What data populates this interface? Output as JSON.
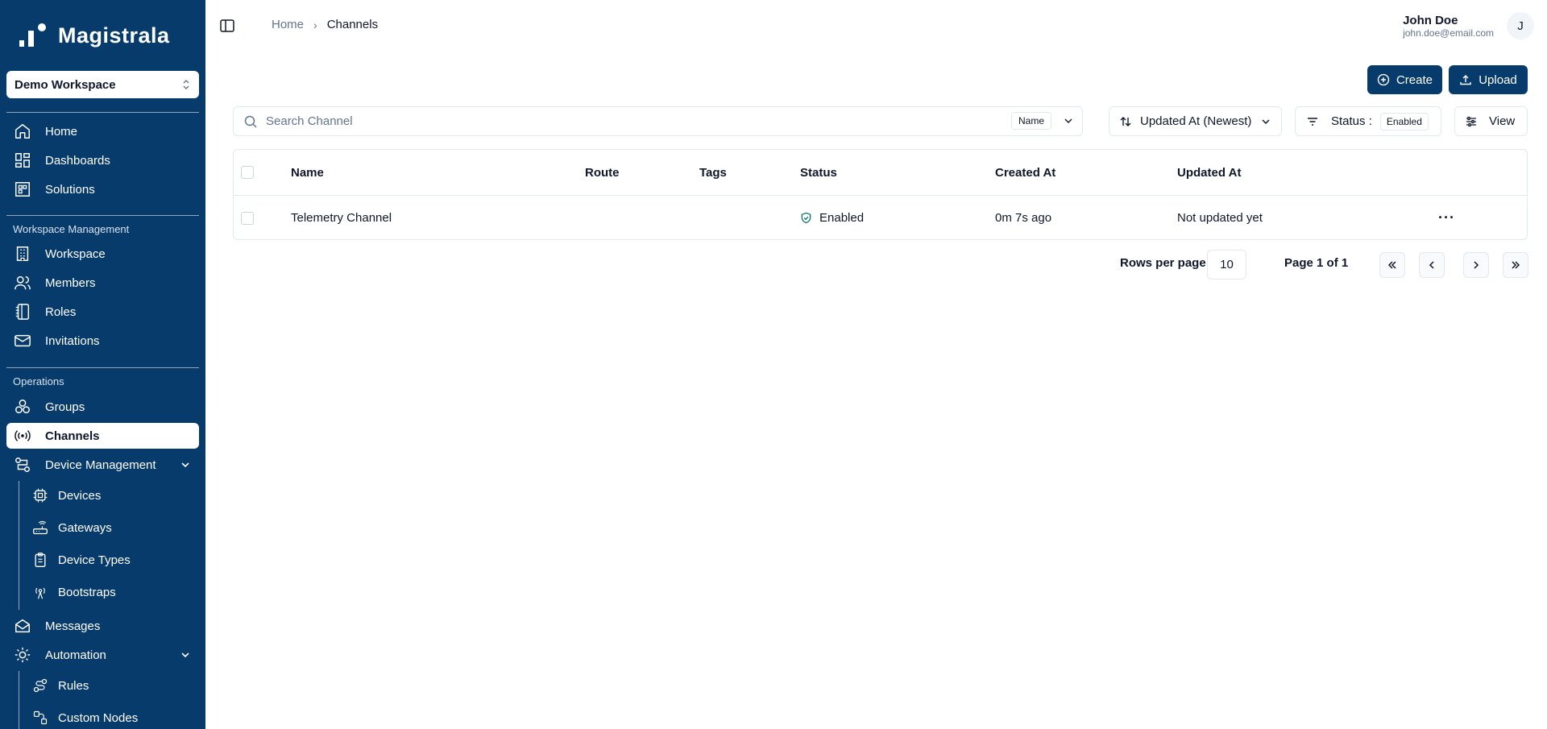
{
  "app": {
    "name": "Magistrala"
  },
  "workspace": {
    "selected": "Demo Workspace"
  },
  "sidebar": {
    "top_items": [
      {
        "label": "Home",
        "icon": "home-icon"
      },
      {
        "label": "Dashboards",
        "icon": "dashboard-icon"
      },
      {
        "label": "Solutions",
        "icon": "solutions-icon"
      }
    ],
    "section_workspace": "Workspace Management",
    "workspace_items": [
      {
        "label": "Workspace",
        "icon": "building-icon"
      },
      {
        "label": "Members",
        "icon": "users-icon"
      },
      {
        "label": "Roles",
        "icon": "notebook-icon"
      },
      {
        "label": "Invitations",
        "icon": "mail-icon"
      }
    ],
    "section_operations": "Operations",
    "operations_items": [
      {
        "label": "Groups",
        "icon": "groups-icon"
      },
      {
        "label": "Channels",
        "icon": "radio-icon",
        "active": true
      },
      {
        "label": "Device Management",
        "icon": "workflow-icon",
        "expanded": true
      }
    ],
    "device_sub_items": [
      {
        "label": "Devices",
        "icon": "cpu-icon"
      },
      {
        "label": "Gateways",
        "icon": "router-icon"
      },
      {
        "label": "Device Types",
        "icon": "clipboard-icon"
      },
      {
        "label": "Bootstraps",
        "icon": "antenna-icon"
      }
    ],
    "messages": {
      "label": "Messages",
      "icon": "mail-open-icon"
    },
    "automation": {
      "label": "Automation",
      "icon": "cog-icon",
      "expanded": true
    },
    "automation_sub_items": [
      {
        "label": "Rules",
        "icon": "route-icon"
      },
      {
        "label": "Custom Nodes",
        "icon": "nodes-icon"
      }
    ]
  },
  "header": {
    "breadcrumb": {
      "home": "Home",
      "current": "Channels"
    },
    "user": {
      "name": "John Doe",
      "email": "john.doe@email.com",
      "initial": "J"
    }
  },
  "actions": {
    "create_label": "Create",
    "upload_label": "Upload"
  },
  "toolbar": {
    "search_placeholder": "Search Channel",
    "search_field": "Name",
    "sort_label": "Updated At (Newest)",
    "status_label": "Status :",
    "status_value": "Enabled",
    "view_label": "View"
  },
  "table": {
    "columns": [
      "Name",
      "Route",
      "Tags",
      "Status",
      "Created At",
      "Updated At"
    ],
    "rows": [
      {
        "name": "Telemetry Channel",
        "route": "",
        "tags": "",
        "status": "Enabled",
        "created_at": "0m 7s ago",
        "updated_at": "Not updated yet",
        "more": "···"
      }
    ]
  },
  "pagination": {
    "rows_per_page_label": "Rows per page",
    "rows_per_page": "10",
    "page_info": "Page 1 of 1"
  },
  "colors": {
    "sidebar_bg": "#073b6b",
    "primary": "#073b6b",
    "status_enabled": "#0f766e"
  }
}
